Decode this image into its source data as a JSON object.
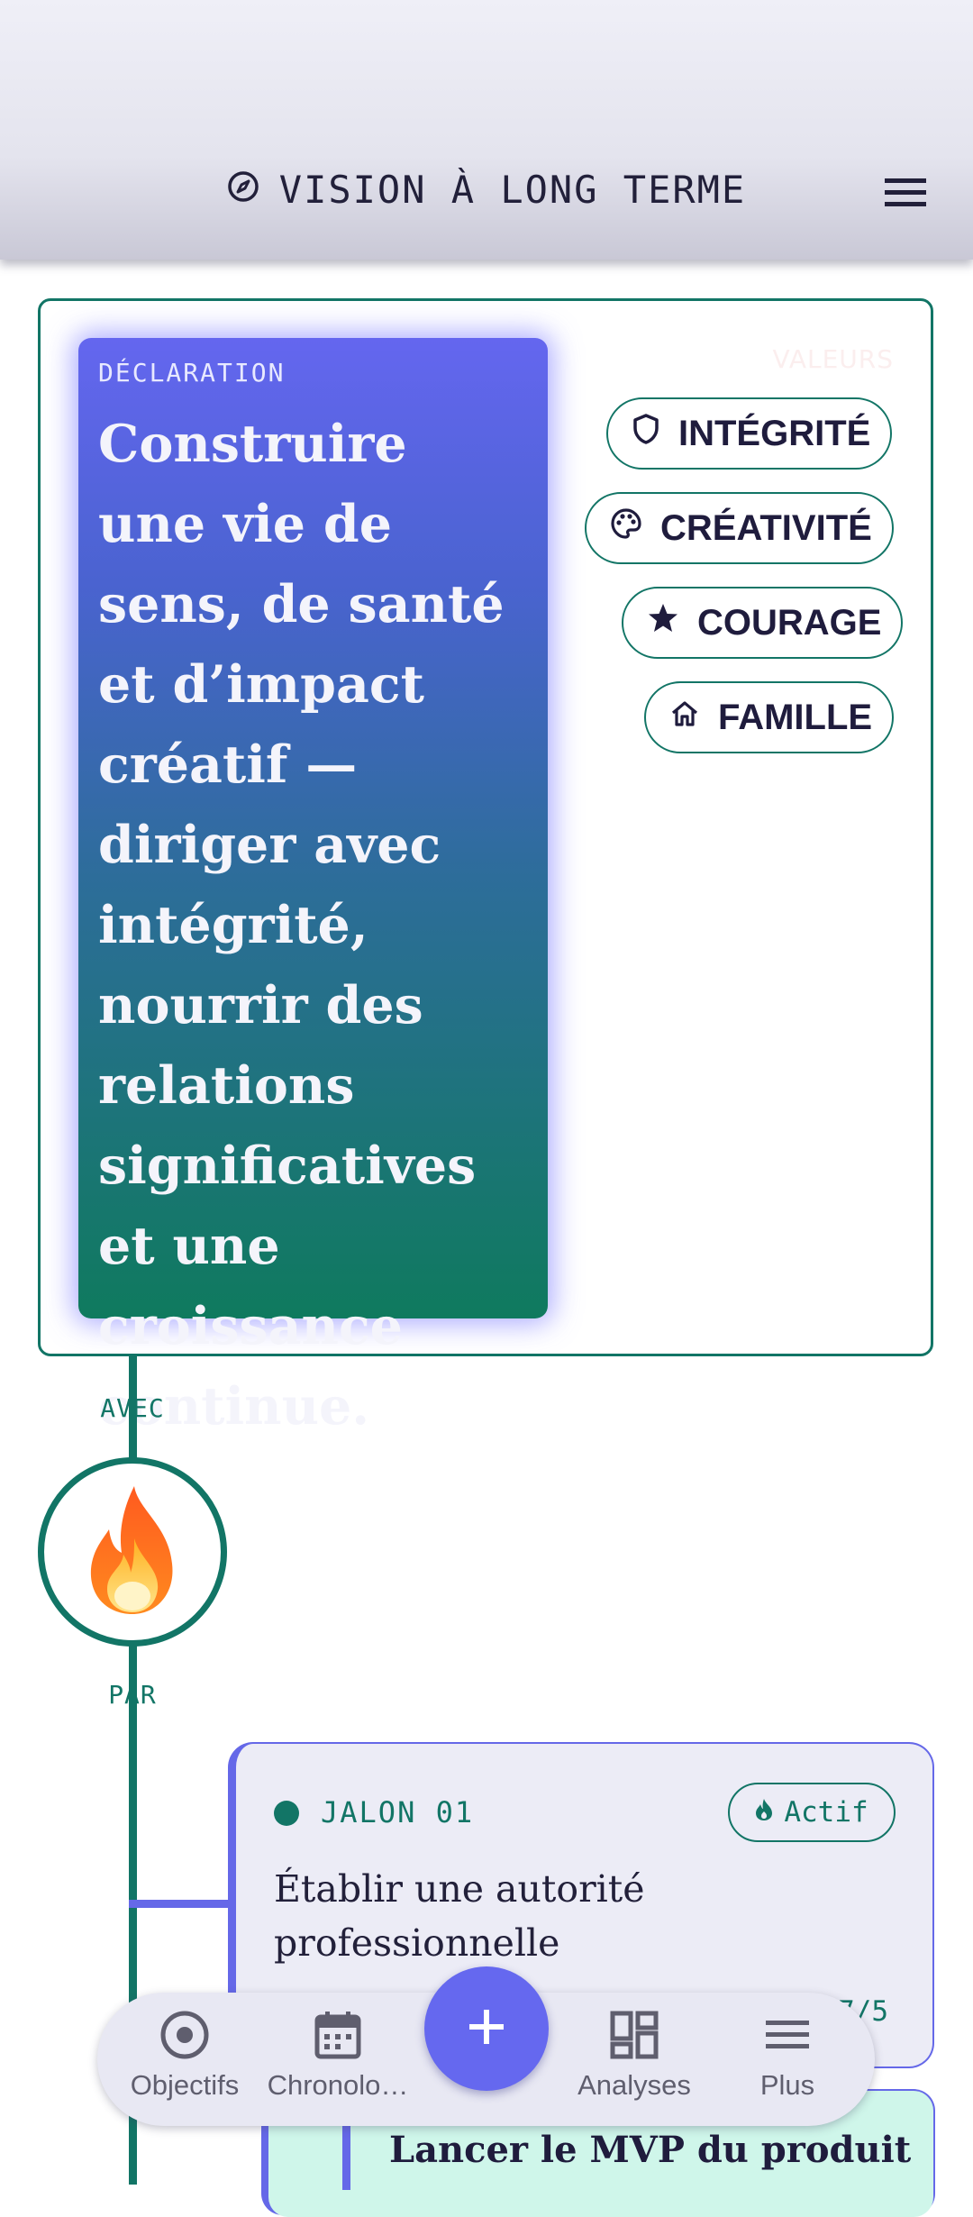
{
  "header": {
    "title": "VISION À LONG TERME",
    "title_icon": "compass-icon",
    "menu_icon": "hamburger-menu-icon"
  },
  "vision": {
    "declaration_label": "DÉCLARATION",
    "declaration_text": "Construire une vie de sens, de santé et d’impact créatif — diriger avec intégrité, nourrir des relations significatives et une croissance continue.",
    "values_label": "VALEURS",
    "values": [
      {
        "label": "INTÉGRITÉ",
        "icon": "shield-icon"
      },
      {
        "label": "CRÉATIVITÉ",
        "icon": "palette-icon"
      },
      {
        "label": "COURAGE",
        "icon": "star-icon"
      },
      {
        "label": "FAMILLE",
        "icon": "home-icon"
      }
    ]
  },
  "timeline": {
    "label_top": "AVEC",
    "label_bottom": "PAR",
    "emoji": "🔥"
  },
  "milestone": {
    "tag": "JALON 01",
    "status": "Actif",
    "title": "Établir une autorité professionnelle",
    "count": "7/5"
  },
  "next_milestone": {
    "title": "Lancer le MVP du produit"
  },
  "bottom_nav": {
    "items": [
      {
        "label": "Objectifs",
        "icon": "target-icon"
      },
      {
        "label": "Chronolo…",
        "icon": "calendar-icon"
      },
      {
        "label": "Analyses",
        "icon": "dashboard-icon"
      },
      {
        "label": "Plus",
        "icon": "menu-icon"
      }
    ],
    "fab_label": "+"
  },
  "colors": {
    "accent": "#6568E8",
    "teal": "#127566",
    "text_dark": "#1F1C3D"
  }
}
